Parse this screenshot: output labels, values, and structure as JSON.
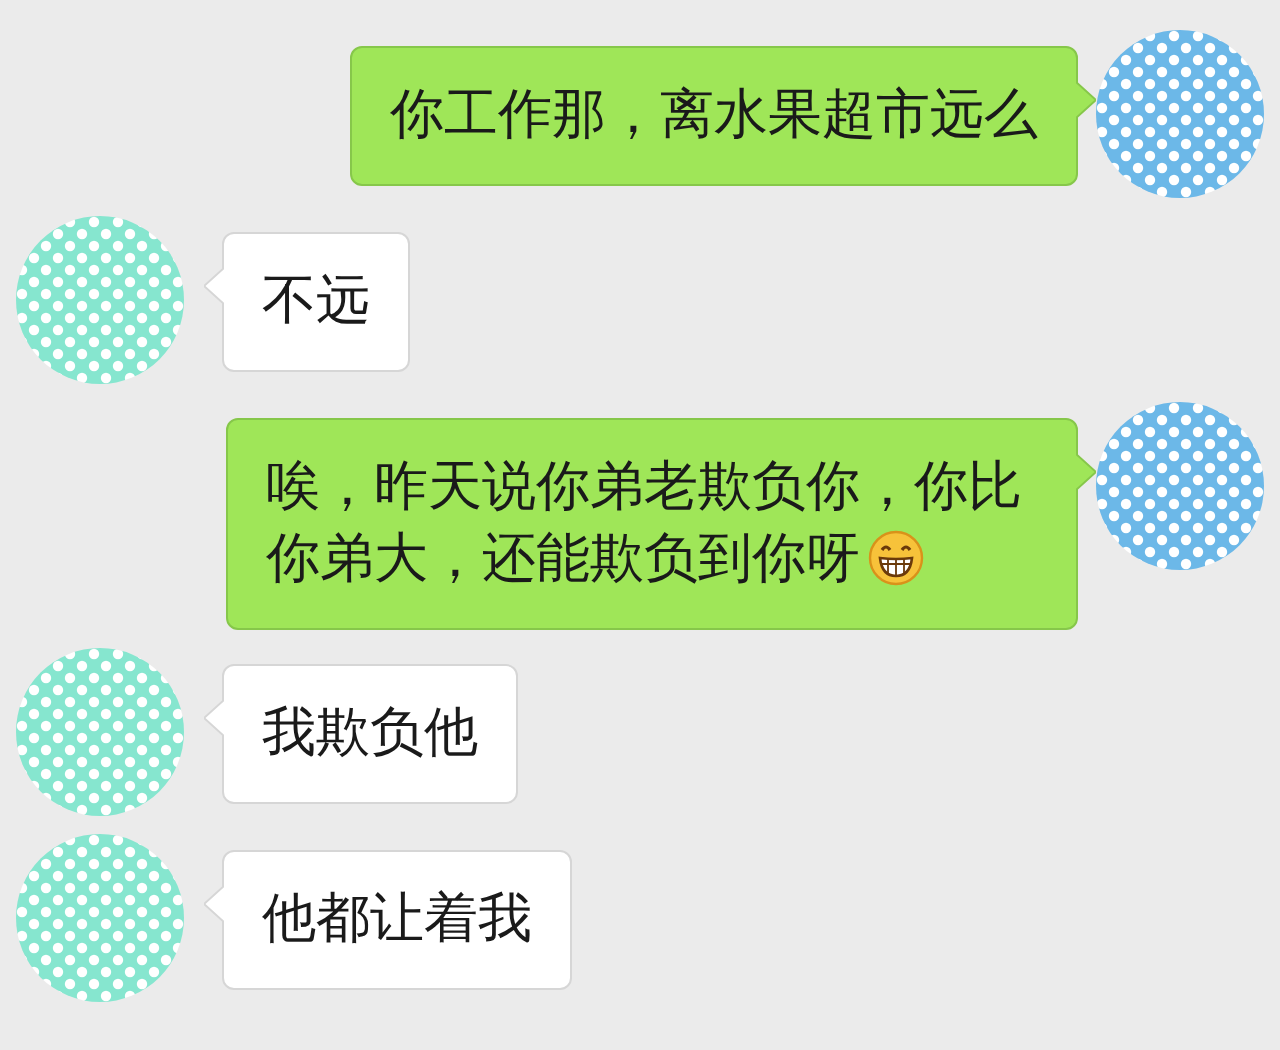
{
  "messages": [
    {
      "kind": "sent",
      "text": "你工作那，离水果超市远么"
    },
    {
      "kind": "received",
      "text": "不远"
    },
    {
      "kind": "sent",
      "text": "唉，昨天说你弟老欺负你，你比你弟大，还能欺负到你呀",
      "emoji": true
    },
    {
      "kind": "received",
      "text": "我欺负他"
    },
    {
      "kind": "received",
      "text": "他都让着我"
    }
  ]
}
